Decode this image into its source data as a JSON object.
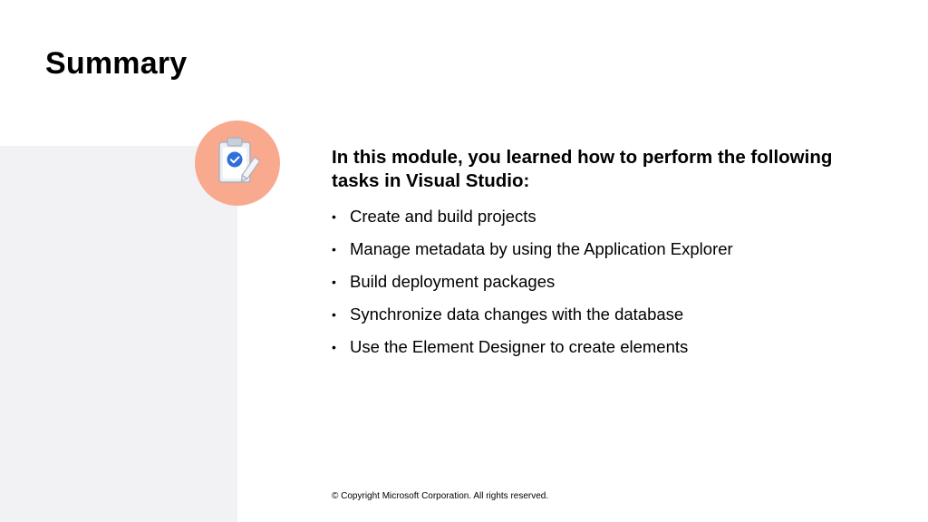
{
  "slide": {
    "title": "Summary",
    "intro": "In this module, you learned how to perform the following tasks in Visual Studio:",
    "bullets": [
      "Create and build projects",
      "Manage metadata by using the Application Explorer",
      "Build deployment packages",
      "Synchronize data changes with the database",
      "Use the Element Designer to create elements"
    ],
    "bullet_marker": "•",
    "copyright": "© Copyright Microsoft Corporation. All rights reserved."
  },
  "icon": {
    "name": "clipboard-check-icon",
    "badge_color": "#f9a98d",
    "check_color": "#2f6fd8"
  },
  "colors": {
    "side_panel": "#f2f2f5",
    "background": "#ffffff",
    "text": "#000000"
  }
}
